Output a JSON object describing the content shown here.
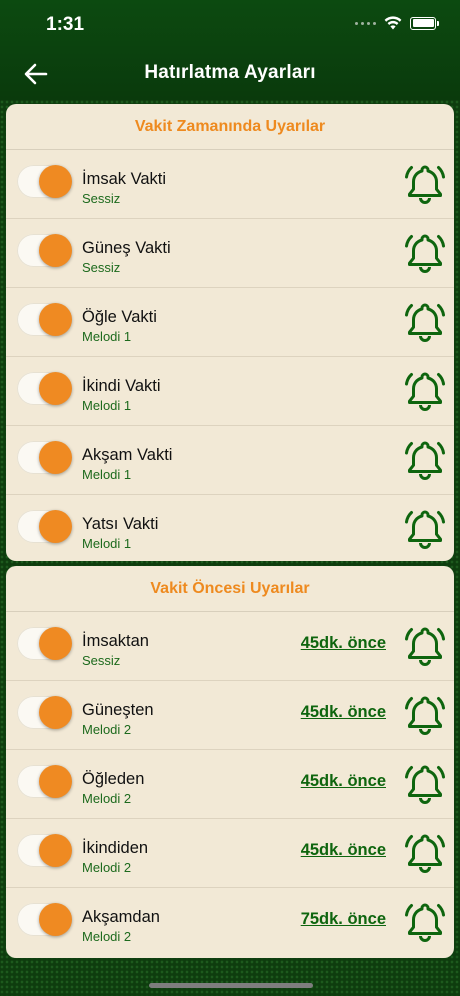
{
  "status_bar": {
    "time": "1:31"
  },
  "header": {
    "title": "Hatırlatma Ayarları",
    "back_icon": "arrow-left-icon"
  },
  "colors": {
    "accent": "#ee8a1f",
    "header_green": "#0c4a10",
    "text_green": "#1d6a1d",
    "card_bg": "#f2e9d6"
  },
  "sections": [
    {
      "title": "Vakit Zamanında Uyarılar",
      "items": [
        {
          "name": "İmsak Vakti",
          "sound": "Sessiz",
          "enabled": true
        },
        {
          "name": "Güneş Vakti",
          "sound": "Sessiz",
          "enabled": true
        },
        {
          "name": "Öğle Vakti",
          "sound": "Melodi 1",
          "enabled": true
        },
        {
          "name": "İkindi Vakti",
          "sound": "Melodi 1",
          "enabled": true
        },
        {
          "name": "Akşam Vakti",
          "sound": "Melodi 1",
          "enabled": true
        },
        {
          "name": "Yatsı Vakti",
          "sound": "Melodi 1",
          "enabled": true
        }
      ]
    },
    {
      "title": "Vakit Öncesi Uyarılar",
      "items": [
        {
          "name": "İmsaktan",
          "sound": "Sessiz",
          "offset": "45dk. önce",
          "enabled": true
        },
        {
          "name": "Güneşten",
          "sound": "Melodi 2",
          "offset": "45dk. önce",
          "enabled": true
        },
        {
          "name": "Öğleden",
          "sound": "Melodi 2",
          "offset": "45dk. önce",
          "enabled": true
        },
        {
          "name": "İkindiden",
          "sound": "Melodi 2",
          "offset": "45dk. önce",
          "enabled": true
        },
        {
          "name": "Akşamdan",
          "sound": "Melodi 2",
          "offset": "75dk. önce",
          "enabled": true
        }
      ]
    }
  ]
}
